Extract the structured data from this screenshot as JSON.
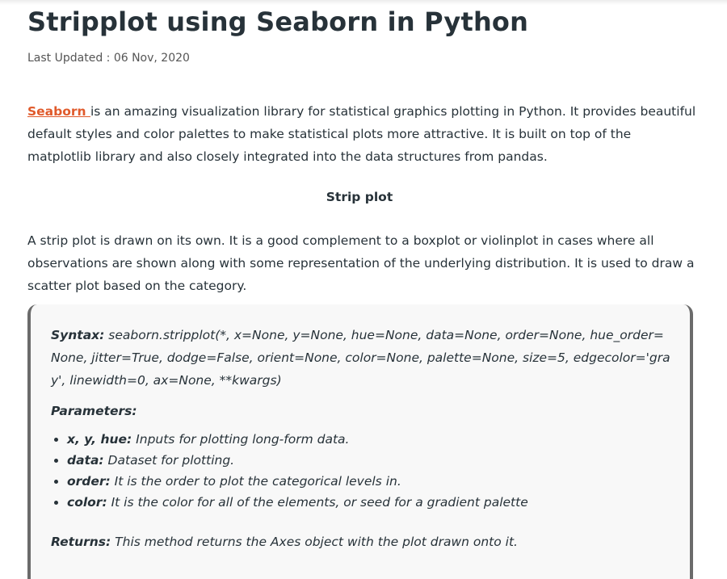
{
  "article": {
    "title": "Stripplot using Seaborn in Python",
    "last_updated": "Last Updated : 06 Nov, 2020",
    "intro_link": "Seaborn ",
    "intro_text": "is an amazing visualization library for statistical graphics plotting in Python. It provides beautiful default styles and color palettes to make statistical plots more attractive. It is built on top of the matplotlib library and also closely integrated into the data structures from pandas.",
    "subheading": "Strip plot",
    "description": "A strip plot is drawn on its own. It is a good complement to a boxplot or violinplot in cases where all observations are shown along with some representation of the underlying distribution. It is used to draw a scatter plot based on the category.",
    "syntax_label": "Syntax:",
    "syntax_text": " seaborn.stripplot(*, x=None, y=None, hue=None, data=None, order=None, hue_order=None, jitter=True, dodge=False, orient=None, color=None, palette=None, size=5, edgecolor='gray', linewidth=0, ax=None, **kwargs)",
    "parameters_label": "Parameters:",
    "parameters": [
      {
        "name": "x, y, hue:",
        "desc": " Inputs for plotting long-form data."
      },
      {
        "name": "data:",
        "desc": " Dataset for plotting."
      },
      {
        "name": "order:",
        "desc": " It is the order to plot the categorical levels in."
      },
      {
        "name": "color:",
        "desc": " It is the color for all of the elements, or seed for a gradient palette"
      }
    ],
    "returns_label": "Returns:",
    "returns_text": " This method returns the Axes object with the plot drawn onto it."
  },
  "colors": {
    "link": "#e05a2b",
    "text": "#273239",
    "box_border": "#6b6b6b",
    "box_bg": "#f8f8f8"
  }
}
